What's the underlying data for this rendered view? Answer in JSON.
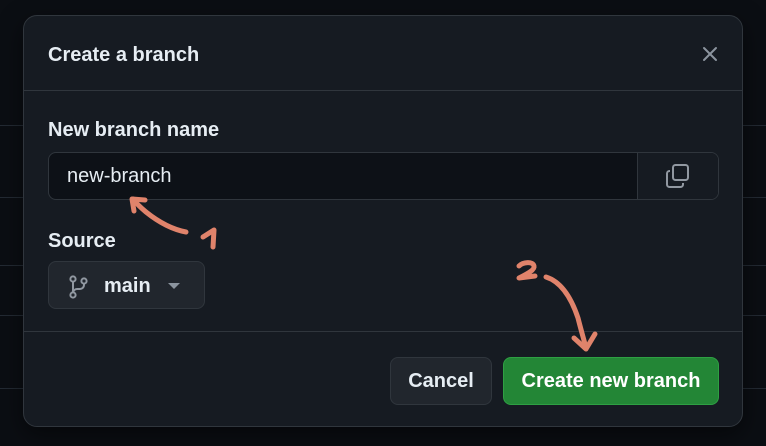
{
  "dialog": {
    "title": "Create a branch",
    "close_icon": "close-icon"
  },
  "branch_name": {
    "label": "New branch name",
    "value": "new-branch",
    "copy_icon": "copy-icon"
  },
  "source": {
    "label": "Source",
    "branch": "main",
    "branch_icon": "git-branch-icon",
    "dropdown_icon": "caret-down-icon"
  },
  "footer": {
    "cancel_label": "Cancel",
    "create_label": "Create new branch"
  },
  "annotations": {
    "step_1": "1",
    "step_2": "2",
    "arrow_color": "#e0836b"
  },
  "colors": {
    "background": "#161b22",
    "border": "#30363d",
    "text": "#e6edf3",
    "primary_button": "#238636"
  }
}
